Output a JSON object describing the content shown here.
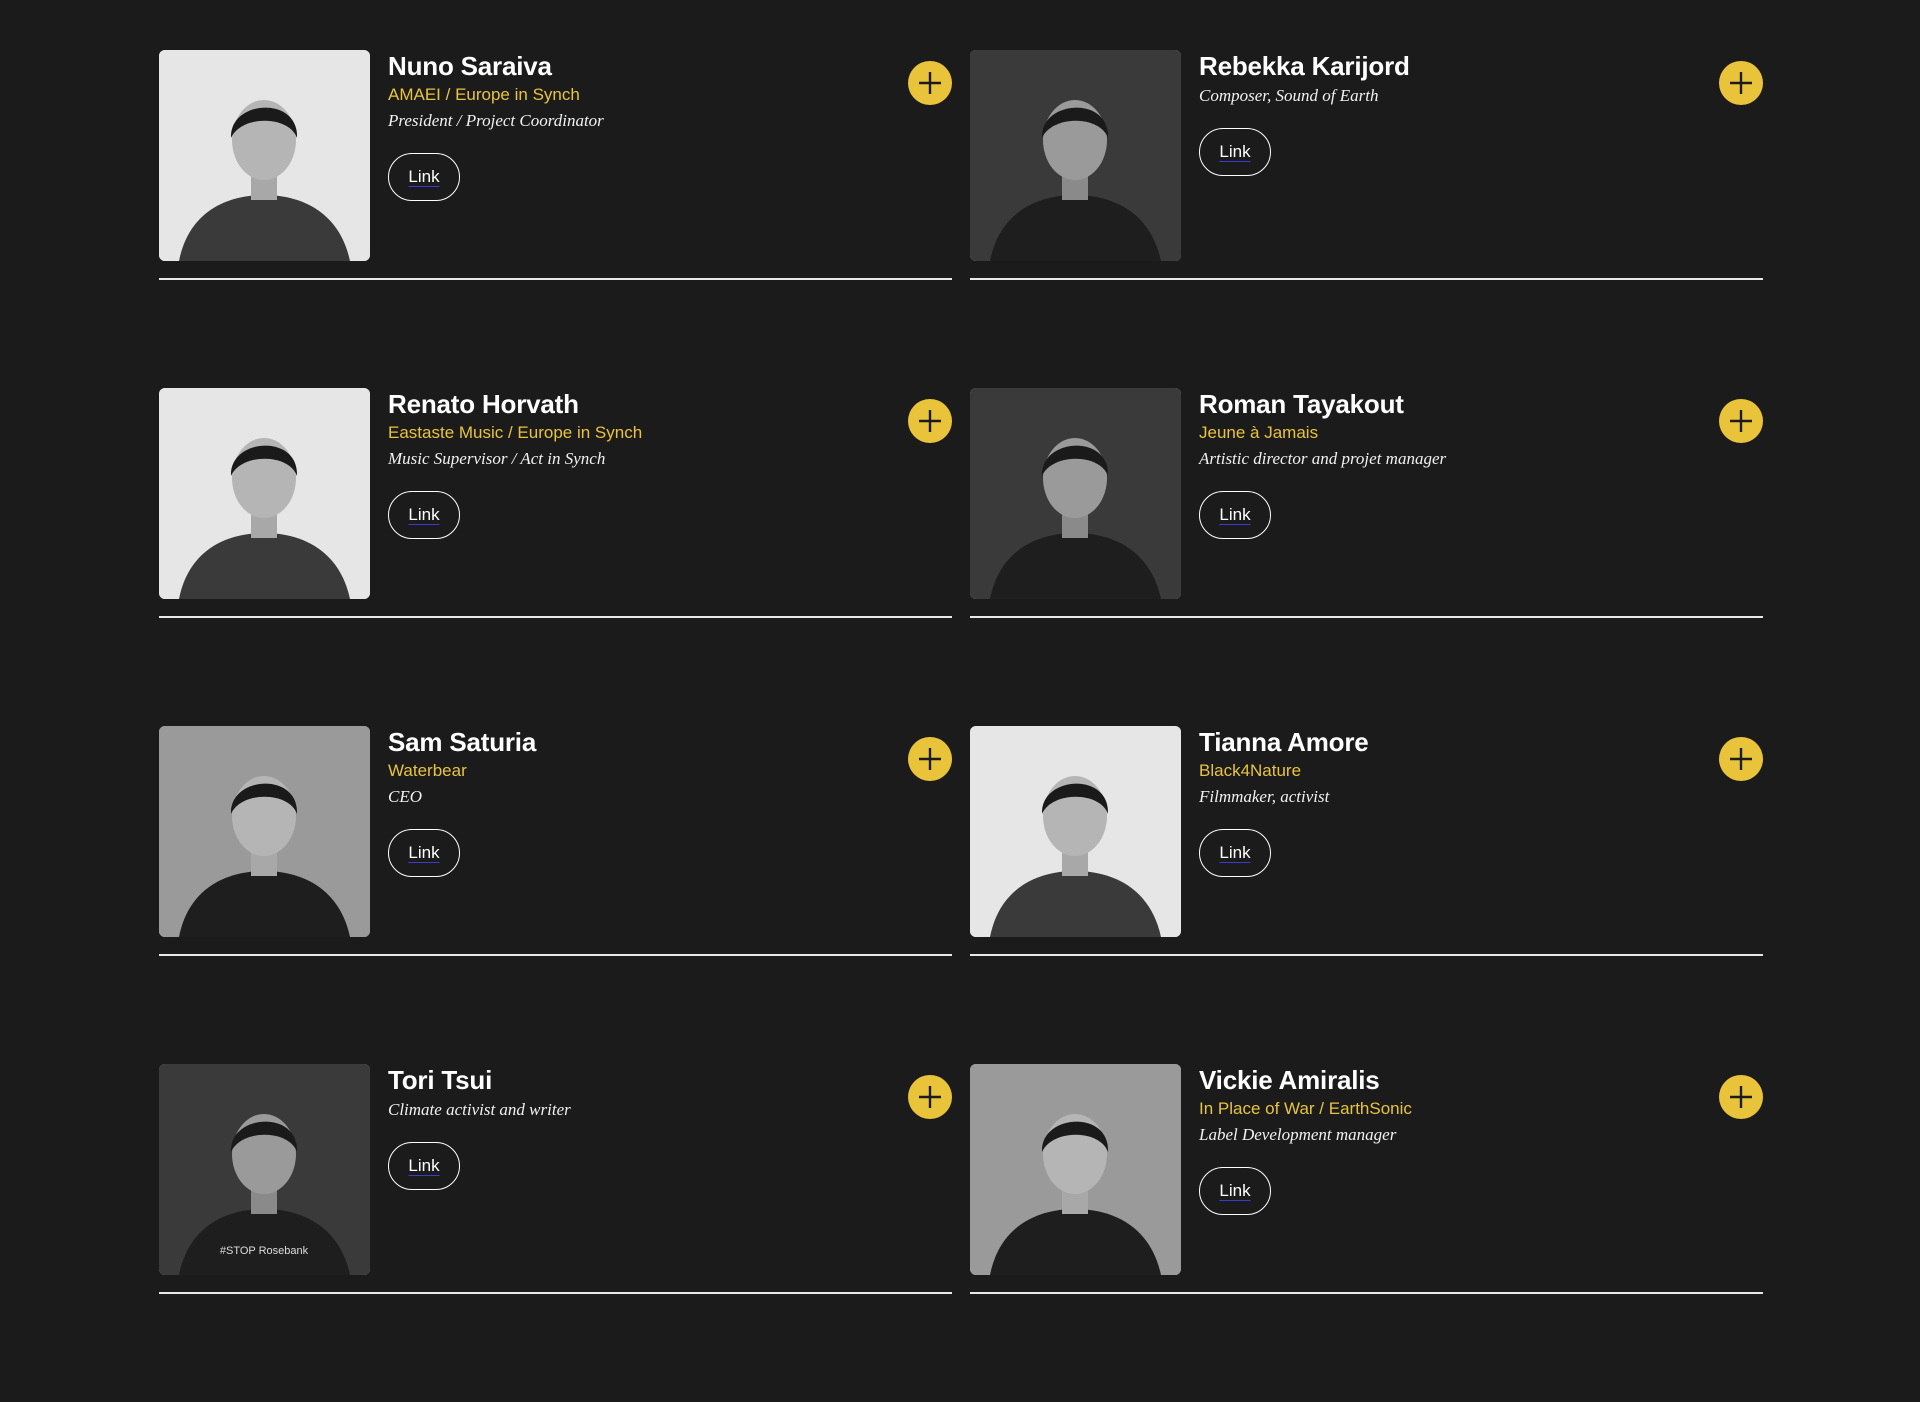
{
  "people": [
    {
      "name": "Nuno Saraiva",
      "org": "AMAEI / Europe in Synch",
      "role": "President / Project Coordinator",
      "link_label": "Link",
      "photo": "portrait-man-dark-jacket",
      "photo_tone": "light"
    },
    {
      "name": "Rebekka Karijord",
      "org": "",
      "role": "Composer, Sound of Earth",
      "link_label": "Link",
      "photo": "woman-wooden-cabin",
      "photo_tone": "dark"
    },
    {
      "name": "Renato Horvath",
      "org": "Eastaste Music / Europe in Synch",
      "role": "Music Supervisor / Act in Synch",
      "link_label": "Link",
      "photo": "portrait-man-curly-hair",
      "photo_tone": "light"
    },
    {
      "name": "Roman Tayakout",
      "org": "Jeune à Jamais",
      "role": "Artistic director and projet manager",
      "link_label": "Link",
      "photo": "man-with-microphone",
      "photo_tone": "dark"
    },
    {
      "name": "Sam Saturia",
      "org": "Waterbear",
      "role": "CEO",
      "link_label": "Link",
      "photo": "portrait-man-beard",
      "photo_tone": "mid"
    },
    {
      "name": "Tianna Amore",
      "org": "Black4Nature",
      "role": "Filmmaker, activist",
      "link_label": "Link",
      "photo": "portrait-woman-curly-hair",
      "photo_tone": "light"
    },
    {
      "name": "Tori Tsui",
      "org": "",
      "role": "Climate activist and writer",
      "link_label": "Link",
      "photo": "woman-black-tshirt",
      "photo_tone": "dark",
      "photo_shirt_text": "#STOP Rosebank"
    },
    {
      "name": "Vickie Amiralis",
      "org": "In Place of War / EarthSonic",
      "role": "Label Development manager",
      "link_label": "Link",
      "photo": "woman-street-market",
      "photo_tone": "mid"
    }
  ],
  "colors": {
    "background": "#1b1b1b",
    "accent": "#e9c43b",
    "text": "#ffffff"
  },
  "icons": {
    "expand": "plus-icon"
  }
}
